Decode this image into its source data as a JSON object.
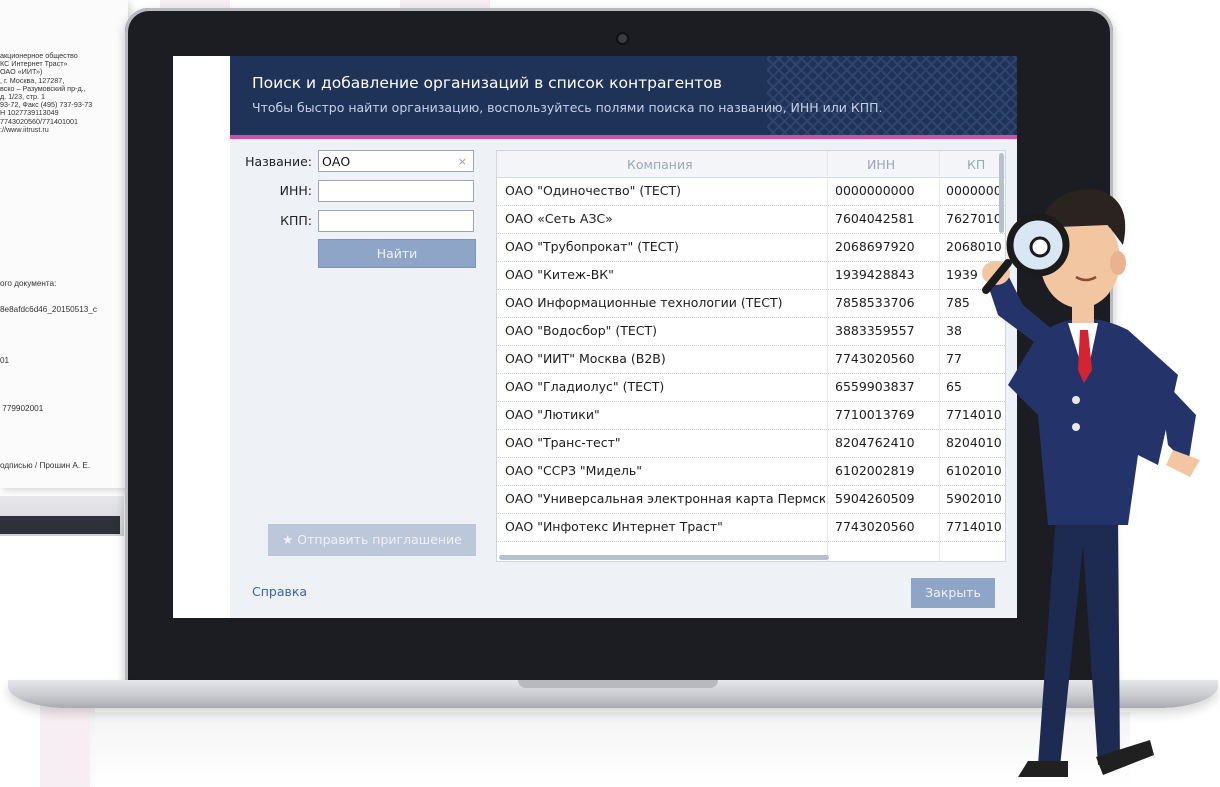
{
  "background_document": {
    "lines": [
      "акционерное общество",
      "КС Интернет Траст»",
      "ОАО «ИИТ»)",
      ", г. Москва, 127287,",
      "вско – Разумовский пр-д.,",
      "д. 1/23, стр. 1",
      "93-72, Факс (495) 737-93-73",
      "Н 1027739113049",
      "7743020560/771401001",
      "://www.iitrust.ru"
    ],
    "doc_label": "ого документа:",
    "doc_hash": "8e8afdc6d46_20150513_c",
    "code_1": "01",
    "code_2": " 779902001",
    "signature": "одписью / Прошин А. Е."
  },
  "dialog": {
    "title": "Поиск и добавление организаций в список контрагентов",
    "subtitle": "Чтобы быстро найти организацию, воспользуйтесь полями поиска по названию, ИНН или КПП.",
    "form": {
      "name_label": "Название:",
      "name_value": "ОАО",
      "clear_glyph": "×",
      "inn_label": "ИНН:",
      "inn_value": "",
      "kpp_label": "КПП:",
      "kpp_value": "",
      "find_button": "Найти"
    },
    "invite_button": "★ Отправить приглашение",
    "help_link": "Справка",
    "close_button": "Закрыть",
    "table": {
      "columns": [
        "Компания",
        "ИНН",
        "КП"
      ],
      "rows": [
        [
          "ОАО \"Одиночество\" (ТЕСТ)",
          "0000000000",
          "0000000"
        ],
        [
          "ОАО «Сеть АЗС»",
          "7604042581",
          "7627010"
        ],
        [
          "ОАО \"Трубопрокат\" (ТЕСТ)",
          "2068697920",
          "2068010"
        ],
        [
          "ОАО \"Китеж-ВК\"",
          "1939428843",
          "1939"
        ],
        [
          "ОАО Информационные технологии (ТЕСТ)",
          "7858533706",
          "785"
        ],
        [
          "ОАО \"Водосбор\" (ТЕСТ)",
          "3883359557",
          "38"
        ],
        [
          "ОАО \"ИИТ\" Москва (B2B)",
          "7743020560",
          "77"
        ],
        [
          "ОАО \"Гладиолус\" (ТЕСТ)",
          "6559903837",
          "65"
        ],
        [
          "ОАО \"Лютики\"",
          "7710013769",
          "7714010"
        ],
        [
          "ОАО \"Транс-тест\"",
          "8204762410",
          "8204010"
        ],
        [
          "ОАО \"ССРЗ \"Мидель\"",
          "6102002819",
          "6102010"
        ],
        [
          "ОАО \"Универсальная электронная карта Пермск...",
          "5904260509",
          "5902010"
        ],
        [
          "ОАО \"Инфотекс Интернет Траст\"",
          "7743020560",
          "7714010"
        ]
      ]
    }
  },
  "colors": {
    "header_bg": "#1f3358",
    "accent": "#d44fa3",
    "button": "#8fa5c8",
    "link": "#3a64b0"
  }
}
